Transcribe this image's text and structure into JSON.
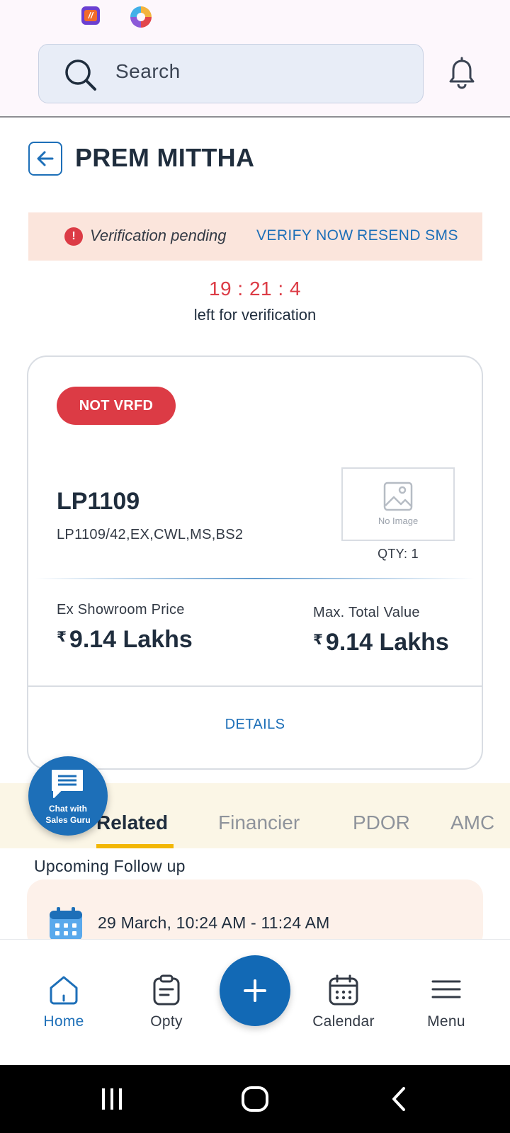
{
  "header": {
    "search_placeholder": "Search"
  },
  "page": {
    "title": "PREM MITTHA"
  },
  "verification": {
    "pending_text": "Verification pending",
    "verify_now_label": "VERIFY NOW",
    "resend_sms_label": "RESEND SMS",
    "countdown": "19 : 21 : 4",
    "countdown_label": "left for verification"
  },
  "product_card": {
    "status_badge": "NOT VRFD",
    "model_code": "LP1109",
    "model_variant": "LP1109/42,EX,CWL,MS,BS2",
    "no_image_text": "No Image",
    "qty_text": "QTY: 1",
    "ex_showroom_label": "Ex Showroom Price",
    "ex_showroom_value": "9.14 Lakhs",
    "max_total_label": "Max. Total Value",
    "max_total_value": "9.14 Lakhs",
    "currency_symbol": "₹",
    "details_label": "DETAILS"
  },
  "chat_fab": {
    "label_line1": "Chat with",
    "label_line2": "Sales Guru"
  },
  "tabs": [
    {
      "label": "Related",
      "active": true
    },
    {
      "label": "Financier",
      "active": false
    },
    {
      "label": "PDOR",
      "active": false
    },
    {
      "label": "AMC",
      "active": false
    }
  ],
  "followup": {
    "title": "Upcoming Follow up",
    "time": "29 March, 10:24 AM - 11:24 AM"
  },
  "bottom_nav": {
    "items": [
      {
        "label": "Home",
        "icon": "home-icon",
        "active": true
      },
      {
        "label": "Opty",
        "icon": "clipboard-icon",
        "active": false
      },
      {
        "label": "Calendar",
        "icon": "calendar-icon",
        "active": false
      },
      {
        "label": "Menu",
        "icon": "hamburger-menu-icon",
        "active": false
      }
    ],
    "add_icon": "plus-icon"
  },
  "colors": {
    "accent_blue": "#1d6fb8",
    "alert_red": "#dc3b45",
    "banner_bg": "#fbe5dc",
    "tab_underline": "#f2b705"
  }
}
